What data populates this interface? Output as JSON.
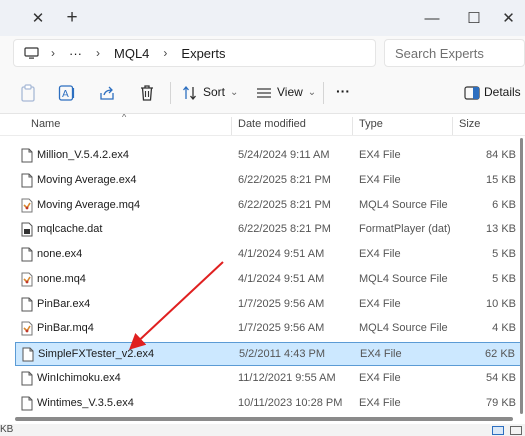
{
  "window": {
    "tab_close_glyph": "✕",
    "new_tab_glyph": "+",
    "min_glyph": "—",
    "max_glyph": "☐",
    "close_glyph": "✕"
  },
  "address": {
    "chevron": "›",
    "ellipsis": "···",
    "crumbs": [
      "MQL4",
      "Experts"
    ]
  },
  "search": {
    "placeholder": "Search Experts"
  },
  "toolbar": {
    "sort_label": "Sort",
    "view_label": "View",
    "more_glyph": "···",
    "details_label": "Details",
    "dropdown_glyph": "⌄"
  },
  "columns": {
    "name": "Name",
    "date": "Date modified",
    "type": "Type",
    "size": "Size"
  },
  "files": [
    {
      "name": "Million_V.5.4.2.ex4",
      "date": "5/24/2024 9:11 AM",
      "type": "EX4 File",
      "size": "84 KB",
      "icon": "doc-icon"
    },
    {
      "name": "Moving Average.ex4",
      "date": "6/22/2025 8:21 PM",
      "type": "EX4 File",
      "size": "15 KB",
      "icon": "doc-icon"
    },
    {
      "name": "Moving Average.mq4",
      "date": "6/22/2025 8:21 PM",
      "type": "MQL4 Source File",
      "size": "6 KB",
      "icon": "mq4-icon"
    },
    {
      "name": "mqlcache.dat",
      "date": "6/22/2025 8:21 PM",
      "type": "FormatPlayer (dat)",
      "size": "13 KB",
      "icon": "dat-icon"
    },
    {
      "name": "none.ex4",
      "date": "4/1/2024 9:51 AM",
      "type": "EX4 File",
      "size": "5 KB",
      "icon": "doc-icon"
    },
    {
      "name": "none.mq4",
      "date": "4/1/2024 9:51 AM",
      "type": "MQL4 Source File",
      "size": "5 KB",
      "icon": "mq4-icon"
    },
    {
      "name": "PinBar.ex4",
      "date": "1/7/2025 9:56 AM",
      "type": "EX4 File",
      "size": "10 KB",
      "icon": "doc-icon"
    },
    {
      "name": "PinBar.mq4",
      "date": "1/7/2025 9:56 AM",
      "type": "MQL4 Source File",
      "size": "4 KB",
      "icon": "mq4-icon"
    },
    {
      "name": "SimpleFXTester_v2.ex4",
      "date": "5/2/2011 4:43 PM",
      "type": "EX4 File",
      "size": "62 KB",
      "icon": "doc-icon",
      "selected": true
    },
    {
      "name": "WinIchimoku.ex4",
      "date": "11/12/2021 9:55 AM",
      "type": "EX4 File",
      "size": "54 KB",
      "icon": "doc-icon"
    },
    {
      "name": "Wintimes_V.3.5.ex4",
      "date": "10/11/2023 10:28 PM",
      "type": "EX4 File",
      "size": "79 KB",
      "icon": "doc-icon"
    }
  ],
  "status": {
    "text": "KB"
  },
  "colors": {
    "selection": "#cce8ff",
    "selection_border": "#5b9bd5",
    "arrow": "#e02020"
  }
}
